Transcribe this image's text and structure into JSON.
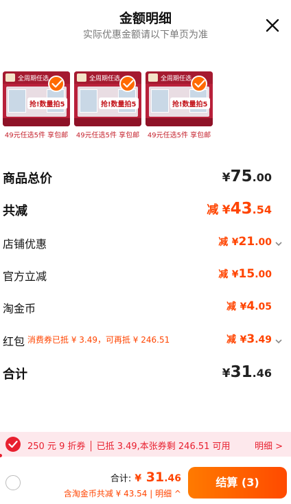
{
  "header": {
    "title": "金额明细",
    "subtitle": "实际优惠金额请以下单页为准"
  },
  "products": [
    {
      "band": "全周期任选",
      "sticker": "抢!数量拍5",
      "caption": "49元任选5件 享包邮"
    },
    {
      "band": "全周期任选",
      "sticker": "抢!数量拍5",
      "caption": "49元任选5件 享包邮"
    },
    {
      "band": "全周期任选",
      "sticker": "抢!数量拍5",
      "caption": "49元任选5件 享包邮"
    }
  ],
  "summary": {
    "goods_total": {
      "label": "商品总价",
      "currency": "¥",
      "int": "75",
      "dec": ".00"
    },
    "total_discount": {
      "label": "共减",
      "prefix": "减",
      "currency": "¥",
      "int": "43",
      "dec": ".54"
    },
    "shop_discount": {
      "label": "店铺优惠",
      "prefix": "减",
      "currency": "¥",
      "int": "21",
      "dec": ".00"
    },
    "official_discount": {
      "label": "官方立减",
      "prefix": "减",
      "currency": "¥",
      "int": "15",
      "dec": ".00"
    },
    "taojinbi": {
      "label": "淘金币",
      "prefix": "减",
      "currency": "¥",
      "int": "4",
      "dec": ".05"
    },
    "red_packet": {
      "label": "红包",
      "note": "消费券已抵 ¥ 3.49，可再抵 ¥ 246.51",
      "prefix": "减",
      "currency": "¥",
      "int": "3",
      "dec": ".49"
    },
    "grand_total": {
      "label": "合计",
      "currency": "¥",
      "int": "31",
      "dec": ".46"
    }
  },
  "coupon_banner": {
    "text": "250 元 9 折券 │ 已抵 3.49,本张券剩 246.51 可用",
    "detail": "明细 >"
  },
  "bottom_bar": {
    "total_label": "合计:",
    "currency": "¥",
    "int": " 31",
    "dec": ".46",
    "sub": "含淘金币共减 ¥ 43.54 | 明细 ^",
    "submit": "结算 (3)"
  },
  "colors": {
    "accent": "#ff4400",
    "red": "#e8202f",
    "banner_bg": "#fde8ec"
  }
}
